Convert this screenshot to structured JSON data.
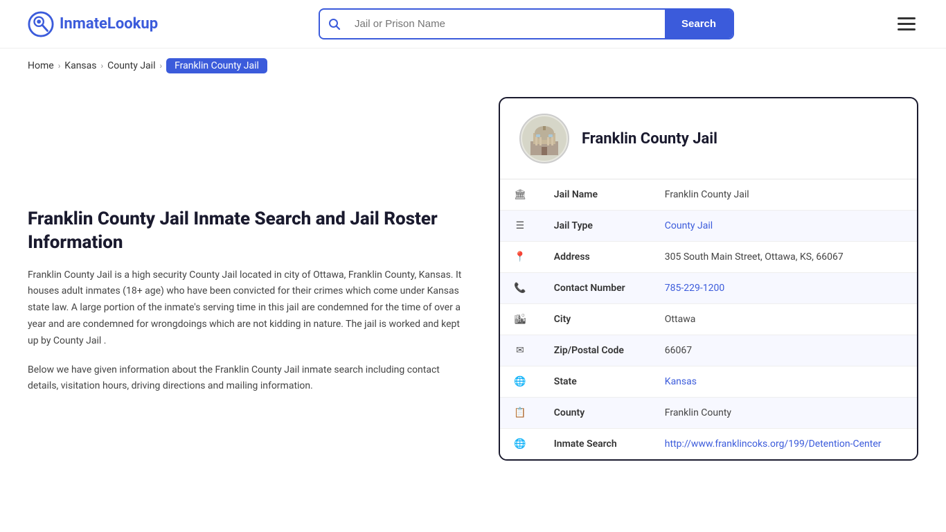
{
  "logo": {
    "text_part1": "Inmate",
    "text_part2": "Lookup"
  },
  "header": {
    "search_placeholder": "Jail or Prison Name",
    "search_button_label": "Search"
  },
  "breadcrumb": {
    "home": "Home",
    "kansas": "Kansas",
    "county_jail": "County Jail",
    "active": "Franklin County Jail"
  },
  "left": {
    "title": "Franklin County Jail Inmate Search and Jail Roster Information",
    "desc1": "Franklin County Jail is a high security County Jail located in city of Ottawa, Franklin County, Kansas. It houses adult inmates (18+ age) who have been convicted for their crimes which come under Kansas state law. A large portion of the inmate's serving time in this jail are condemned for the time of over a year and are condemned for wrongdoings which are not kidding in nature. The jail is worked and kept up by County Jail .",
    "desc2": "Below we have given information about the Franklin County Jail inmate search including contact details, visitation hours, driving directions and mailing information."
  },
  "card": {
    "title": "Franklin County Jail",
    "fields": [
      {
        "label": "Jail Name",
        "value": "Franklin County Jail",
        "link": null,
        "icon": "🏛"
      },
      {
        "label": "Jail Type",
        "value": "County Jail",
        "link": "#",
        "icon": "☰"
      },
      {
        "label": "Address",
        "value": "305 South Main Street, Ottawa, KS, 66067",
        "link": null,
        "icon": "📍"
      },
      {
        "label": "Contact Number",
        "value": "785-229-1200",
        "link": "tel:785-229-1200",
        "icon": "📞"
      },
      {
        "label": "City",
        "value": "Ottawa",
        "link": null,
        "icon": "🏙"
      },
      {
        "label": "Zip/Postal Code",
        "value": "66067",
        "link": null,
        "icon": "✉"
      },
      {
        "label": "State",
        "value": "Kansas",
        "link": "#",
        "icon": "🌐"
      },
      {
        "label": "County",
        "value": "Franklin County",
        "link": null,
        "icon": "📋"
      },
      {
        "label": "Inmate Search",
        "value": "http://www.franklincoks.org/199/Detention-Center",
        "link": "http://www.franklincoks.org/199/Detention-Center",
        "icon": "🌐"
      }
    ]
  }
}
